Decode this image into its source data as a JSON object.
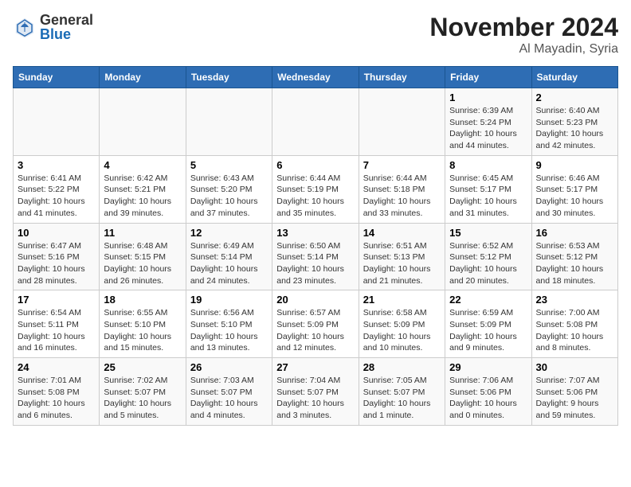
{
  "header": {
    "logo_general": "General",
    "logo_blue": "Blue",
    "month": "November 2024",
    "location": "Al Mayadin, Syria"
  },
  "weekdays": [
    "Sunday",
    "Monday",
    "Tuesday",
    "Wednesday",
    "Thursday",
    "Friday",
    "Saturday"
  ],
  "weeks": [
    [
      {
        "day": "",
        "info": ""
      },
      {
        "day": "",
        "info": ""
      },
      {
        "day": "",
        "info": ""
      },
      {
        "day": "",
        "info": ""
      },
      {
        "day": "",
        "info": ""
      },
      {
        "day": "1",
        "info": "Sunrise: 6:39 AM\nSunset: 5:24 PM\nDaylight: 10 hours and 44 minutes."
      },
      {
        "day": "2",
        "info": "Sunrise: 6:40 AM\nSunset: 5:23 PM\nDaylight: 10 hours and 42 minutes."
      }
    ],
    [
      {
        "day": "3",
        "info": "Sunrise: 6:41 AM\nSunset: 5:22 PM\nDaylight: 10 hours and 41 minutes."
      },
      {
        "day": "4",
        "info": "Sunrise: 6:42 AM\nSunset: 5:21 PM\nDaylight: 10 hours and 39 minutes."
      },
      {
        "day": "5",
        "info": "Sunrise: 6:43 AM\nSunset: 5:20 PM\nDaylight: 10 hours and 37 minutes."
      },
      {
        "day": "6",
        "info": "Sunrise: 6:44 AM\nSunset: 5:19 PM\nDaylight: 10 hours and 35 minutes."
      },
      {
        "day": "7",
        "info": "Sunrise: 6:44 AM\nSunset: 5:18 PM\nDaylight: 10 hours and 33 minutes."
      },
      {
        "day": "8",
        "info": "Sunrise: 6:45 AM\nSunset: 5:17 PM\nDaylight: 10 hours and 31 minutes."
      },
      {
        "day": "9",
        "info": "Sunrise: 6:46 AM\nSunset: 5:17 PM\nDaylight: 10 hours and 30 minutes."
      }
    ],
    [
      {
        "day": "10",
        "info": "Sunrise: 6:47 AM\nSunset: 5:16 PM\nDaylight: 10 hours and 28 minutes."
      },
      {
        "day": "11",
        "info": "Sunrise: 6:48 AM\nSunset: 5:15 PM\nDaylight: 10 hours and 26 minutes."
      },
      {
        "day": "12",
        "info": "Sunrise: 6:49 AM\nSunset: 5:14 PM\nDaylight: 10 hours and 24 minutes."
      },
      {
        "day": "13",
        "info": "Sunrise: 6:50 AM\nSunset: 5:14 PM\nDaylight: 10 hours and 23 minutes."
      },
      {
        "day": "14",
        "info": "Sunrise: 6:51 AM\nSunset: 5:13 PM\nDaylight: 10 hours and 21 minutes."
      },
      {
        "day": "15",
        "info": "Sunrise: 6:52 AM\nSunset: 5:12 PM\nDaylight: 10 hours and 20 minutes."
      },
      {
        "day": "16",
        "info": "Sunrise: 6:53 AM\nSunset: 5:12 PM\nDaylight: 10 hours and 18 minutes."
      }
    ],
    [
      {
        "day": "17",
        "info": "Sunrise: 6:54 AM\nSunset: 5:11 PM\nDaylight: 10 hours and 16 minutes."
      },
      {
        "day": "18",
        "info": "Sunrise: 6:55 AM\nSunset: 5:10 PM\nDaylight: 10 hours and 15 minutes."
      },
      {
        "day": "19",
        "info": "Sunrise: 6:56 AM\nSunset: 5:10 PM\nDaylight: 10 hours and 13 minutes."
      },
      {
        "day": "20",
        "info": "Sunrise: 6:57 AM\nSunset: 5:09 PM\nDaylight: 10 hours and 12 minutes."
      },
      {
        "day": "21",
        "info": "Sunrise: 6:58 AM\nSunset: 5:09 PM\nDaylight: 10 hours and 10 minutes."
      },
      {
        "day": "22",
        "info": "Sunrise: 6:59 AM\nSunset: 5:09 PM\nDaylight: 10 hours and 9 minutes."
      },
      {
        "day": "23",
        "info": "Sunrise: 7:00 AM\nSunset: 5:08 PM\nDaylight: 10 hours and 8 minutes."
      }
    ],
    [
      {
        "day": "24",
        "info": "Sunrise: 7:01 AM\nSunset: 5:08 PM\nDaylight: 10 hours and 6 minutes."
      },
      {
        "day": "25",
        "info": "Sunrise: 7:02 AM\nSunset: 5:07 PM\nDaylight: 10 hours and 5 minutes."
      },
      {
        "day": "26",
        "info": "Sunrise: 7:03 AM\nSunset: 5:07 PM\nDaylight: 10 hours and 4 minutes."
      },
      {
        "day": "27",
        "info": "Sunrise: 7:04 AM\nSunset: 5:07 PM\nDaylight: 10 hours and 3 minutes."
      },
      {
        "day": "28",
        "info": "Sunrise: 7:05 AM\nSunset: 5:07 PM\nDaylight: 10 hours and 1 minute."
      },
      {
        "day": "29",
        "info": "Sunrise: 7:06 AM\nSunset: 5:06 PM\nDaylight: 10 hours and 0 minutes."
      },
      {
        "day": "30",
        "info": "Sunrise: 7:07 AM\nSunset: 5:06 PM\nDaylight: 9 hours and 59 minutes."
      }
    ]
  ]
}
